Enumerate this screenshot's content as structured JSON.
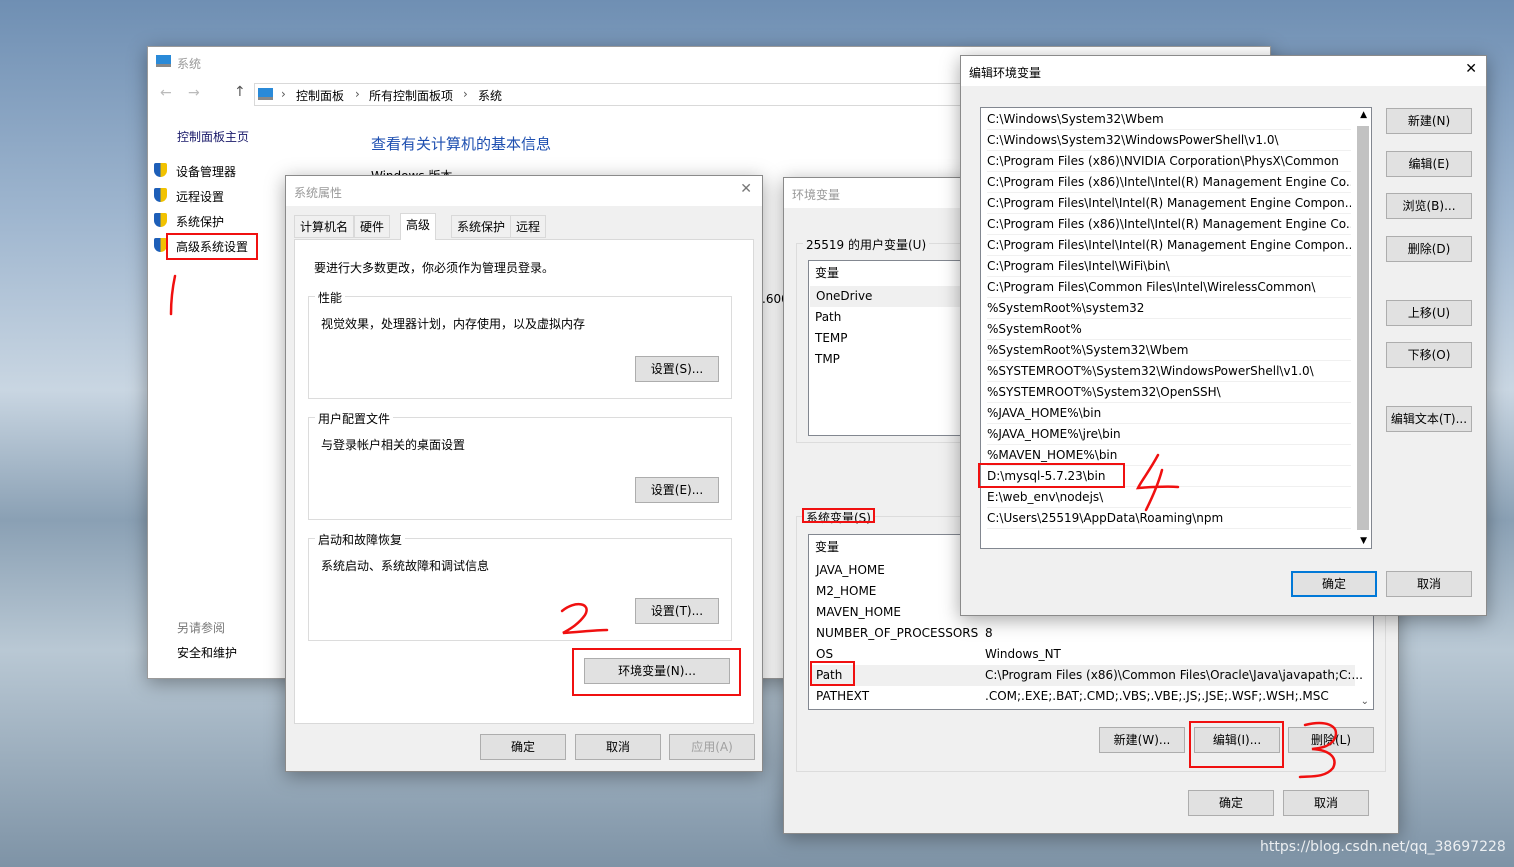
{
  "system_window": {
    "title": "系统",
    "breadcrumb": [
      "控制面板",
      "所有控制面板项",
      "系统"
    ],
    "home": "控制面板主页",
    "nav": [
      "设备管理器",
      "远程设置",
      "系统保护",
      "高级系统设置"
    ],
    "heading": "查看有关计算机的基本信息",
    "windows_version": "Windows 版本",
    "partial": ".600",
    "see_also": "另请参阅",
    "security": "安全和维护"
  },
  "sysprops": {
    "title": "系统属性",
    "tabs": [
      "计算机名",
      "硬件",
      "高级",
      "系统保护",
      "远程"
    ],
    "active_tab": "高级",
    "admin_note": "要进行大多数更改，你必须作为管理员登录。",
    "groups": [
      {
        "label": "性能",
        "desc": "视觉效果，处理器计划，内存使用，以及虚拟内存",
        "button": "设置(S)..."
      },
      {
        "label": "用户配置文件",
        "desc": "与登录帐户相关的桌面设置",
        "button": "设置(E)..."
      },
      {
        "label": "启动和故障恢复",
        "desc": "系统启动、系统故障和调试信息",
        "button": "设置(T)..."
      }
    ],
    "env_button": "环境变量(N)...",
    "ok": "确定",
    "cancel": "取消",
    "apply": "应用(A)"
  },
  "envvars": {
    "title": "环境变量",
    "user_label": "25519 的用户变量(U)",
    "col_var": "变量",
    "user_vars": [
      "OneDrive",
      "Path",
      "TEMP",
      "TMP"
    ],
    "sys_label": "系统变量(S)",
    "sys_vars": [
      {
        "name": "JAVA_HOME",
        "value": ""
      },
      {
        "name": "M2_HOME",
        "value": ""
      },
      {
        "name": "MAVEN_HOME",
        "value": ""
      },
      {
        "name": "NUMBER_OF_PROCESSORS",
        "value": "8"
      },
      {
        "name": "OS",
        "value": "Windows_NT"
      },
      {
        "name": "Path",
        "value": "C:\\Program Files (x86)\\Common Files\\Oracle\\Java\\javapath;C:..."
      },
      {
        "name": "PATHEXT",
        "value": ".COM;.EXE;.BAT;.CMD;.VBS;.VBE;.JS;.JSE;.WSF;.WSH;.MSC"
      }
    ],
    "new": "新建(W)...",
    "edit": "编辑(I)...",
    "delete": "删除(L)",
    "ok": "确定",
    "cancel": "取消"
  },
  "editenv": {
    "title": "编辑环境变量",
    "entries": [
      "C:\\Windows\\System32\\Wbem",
      "C:\\Windows\\System32\\WindowsPowerShell\\v1.0\\",
      "C:\\Program Files (x86)\\NVIDIA Corporation\\PhysX\\Common",
      "C:\\Program Files (x86)\\Intel\\Intel(R) Management Engine Co...",
      "C:\\Program Files\\Intel\\Intel(R) Management Engine Compon...",
      "C:\\Program Files (x86)\\Intel\\Intel(R) Management Engine Co...",
      "C:\\Program Files\\Intel\\Intel(R) Management Engine Compon...",
      "C:\\Program Files\\Intel\\WiFi\\bin\\",
      "C:\\Program Files\\Common Files\\Intel\\WirelessCommon\\",
      "%SystemRoot%\\system32",
      "%SystemRoot%",
      "%SystemRoot%\\System32\\Wbem",
      "%SYSTEMROOT%\\System32\\WindowsPowerShell\\v1.0\\",
      "%SYSTEMROOT%\\System32\\OpenSSH\\",
      "%JAVA_HOME%\\bin",
      "%JAVA_HOME%\\jre\\bin",
      "%MAVEN_HOME%\\bin",
      "D:\\mysql-5.7.23\\bin",
      "E:\\web_env\\nodejs\\",
      "C:\\Users\\25519\\AppData\\Roaming\\npm"
    ],
    "buttons": [
      "新建(N)",
      "编辑(E)",
      "浏览(B)...",
      "删除(D)",
      "上移(U)",
      "下移(O)",
      "编辑文本(T)..."
    ],
    "ok": "确定",
    "cancel": "取消"
  },
  "annotations": {
    "color": "#f01010",
    "numbers": [
      "1",
      "2",
      "3",
      "4"
    ]
  },
  "watermark": "https://blog.csdn.net/qq_38697228"
}
